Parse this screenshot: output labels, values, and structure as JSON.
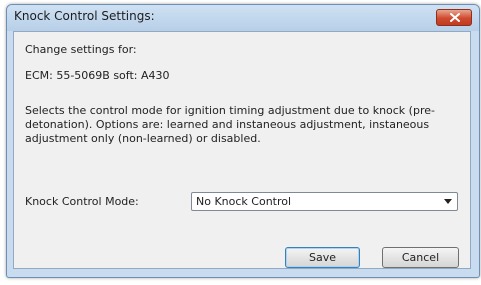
{
  "window": {
    "title": "Knock Control Settings:"
  },
  "content": {
    "change_label": "Change settings for:",
    "ecm_label": "ECM: 55-5069B soft: A430",
    "description": "Selects the control mode for ignition timing adjustment due to knock (pre-detonation). Options are: learned and instaneous adjustment, instaneous adjustment only (non-learned) or disabled.",
    "mode_label": "Knock Control Mode:",
    "mode_value": "No Knock Control"
  },
  "buttons": {
    "save": "Save",
    "cancel": "Cancel"
  },
  "icons": {
    "close": "close-icon",
    "dropdown": "chevron-down-icon"
  },
  "colors": {
    "close_button": "#cf4a2f",
    "title_bar": "#b7cfe8",
    "default_button_border": "#3c7fb1"
  }
}
